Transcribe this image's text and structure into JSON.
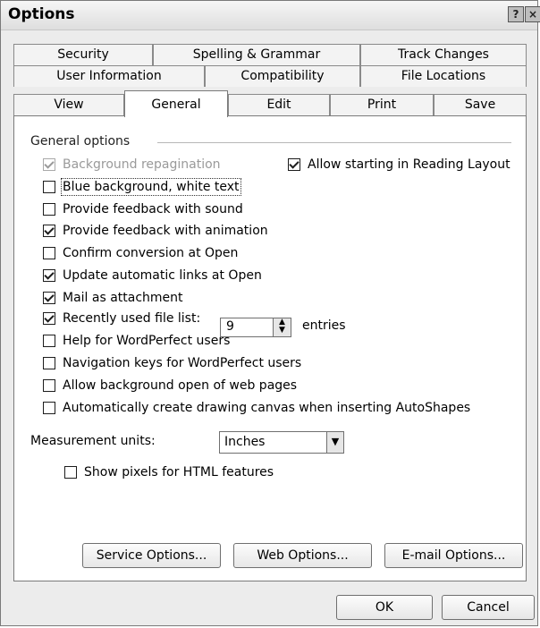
{
  "window": {
    "title": "Options",
    "help_glyph": "?",
    "close_glyph": "×"
  },
  "tabs": {
    "row1": [
      {
        "label": "Security"
      },
      {
        "label": "Spelling & Grammar"
      },
      {
        "label": "Track Changes"
      }
    ],
    "row2": [
      {
        "label": "User Information"
      },
      {
        "label": "Compatibility"
      },
      {
        "label": "File Locations"
      }
    ],
    "row3": [
      {
        "label": "View"
      },
      {
        "label": "General"
      },
      {
        "label": "Edit"
      },
      {
        "label": "Print"
      },
      {
        "label": "Save"
      }
    ]
  },
  "group": {
    "title": "General options"
  },
  "options": {
    "background_repagination": "Background repagination",
    "allow_reading_layout": "Allow starting in Reading Layout",
    "blue_background": "Blue background, white text",
    "feedback_sound": "Provide feedback with sound",
    "feedback_animation": "Provide feedback with animation",
    "confirm_conversion": "Confirm conversion at Open",
    "update_links": "Update automatic links at Open",
    "mail_attachment": "Mail as attachment",
    "recently_used": "Recently used file list:",
    "recent_count": "9",
    "entries": "entries",
    "help_wordperfect": "Help for WordPerfect users",
    "nav_wordperfect": "Navigation keys for WordPerfect users",
    "background_web": "Allow background open of web pages",
    "drawing_canvas": "Automatically create drawing canvas when inserting AutoShapes",
    "show_pixels": "Show pixels for HTML features"
  },
  "measurement": {
    "label": "Measurement units:",
    "value": "Inches"
  },
  "buttons": {
    "service": "Service Options...",
    "web": "Web Options...",
    "email": "E-mail Options...",
    "ok": "OK",
    "cancel": "Cancel"
  }
}
